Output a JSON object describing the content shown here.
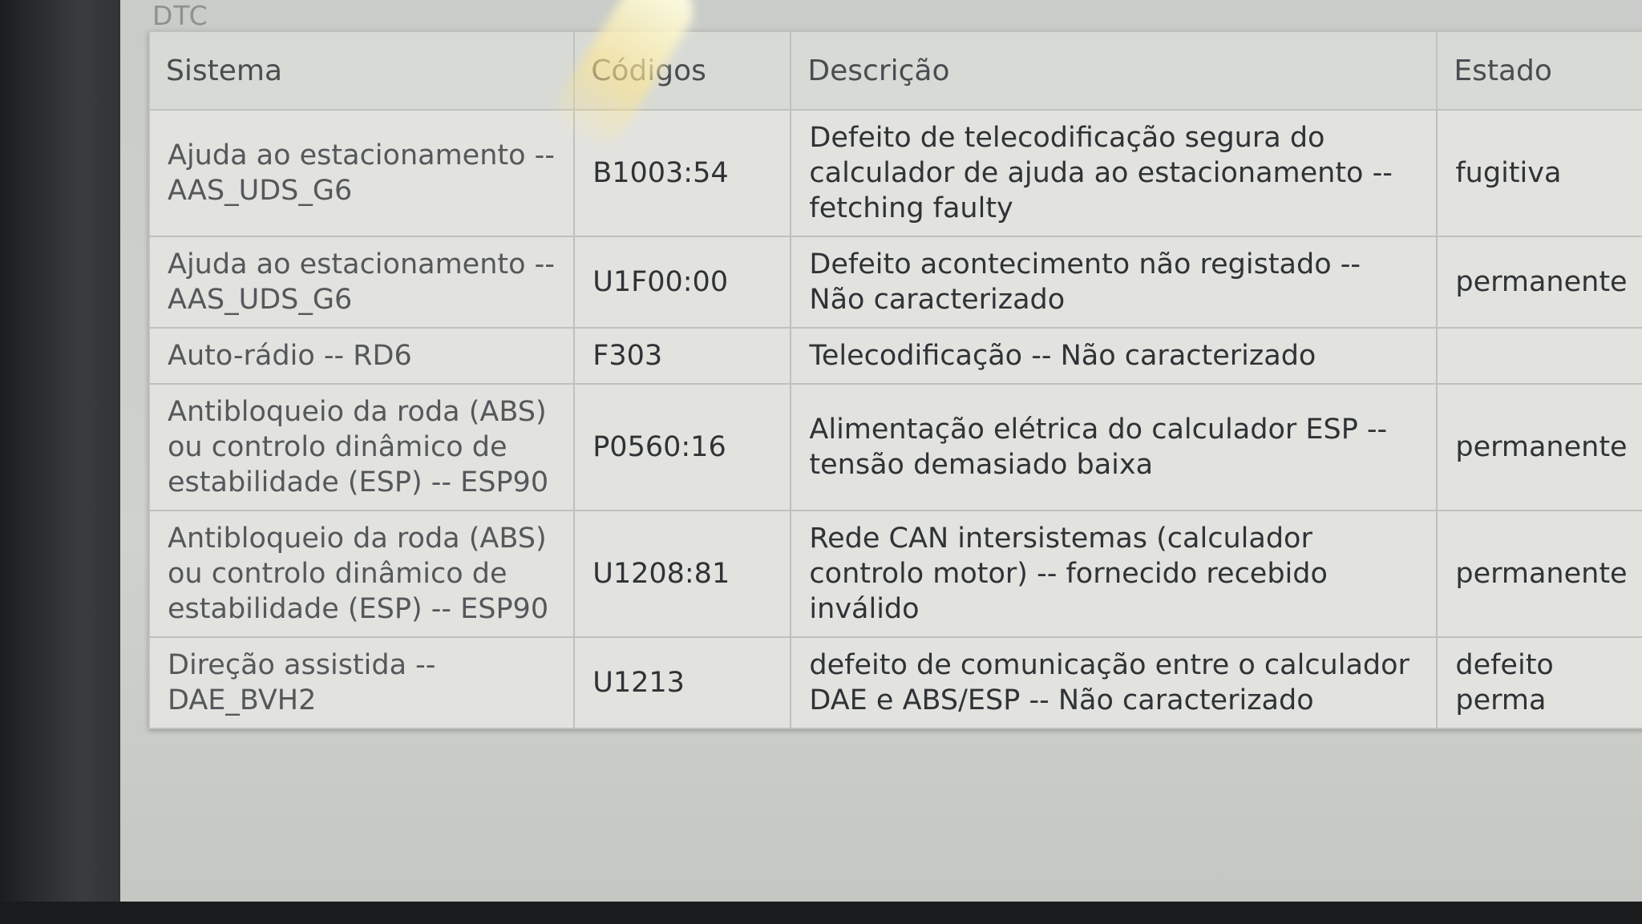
{
  "section": {
    "title": "DTC"
  },
  "table": {
    "headers": {
      "system": "Sistema",
      "code": "Códigos",
      "description": "Descrição",
      "state": "Estado"
    },
    "rows": [
      {
        "system": "Ajuda ao estacionamento -- AAS_UDS_G6",
        "code": "B1003:54",
        "description": "Defeito de telecodificação segura do calculador de ajuda ao estacionamento -- fetching faulty",
        "state": "fugitiva"
      },
      {
        "system": "Ajuda ao estacionamento -- AAS_UDS_G6",
        "code": "U1F00:00",
        "description": "Defeito acontecimento não registado -- Não caracterizado",
        "state": "permanente"
      },
      {
        "system": "Auto-rádio -- RD6",
        "code": "F303",
        "description": "Telecodificação -- Não caracterizado",
        "state": ""
      },
      {
        "system": "Antibloqueio da roda (ABS) ou controlo dinâmico de estabilidade (ESP) -- ESP90",
        "code": "P0560:16",
        "description": "Alimentação elétrica do calculador ESP -- tensão demasiado baixa",
        "state": "permanente"
      },
      {
        "system": "Antibloqueio da roda (ABS) ou controlo dinâmico de estabilidade (ESP) -- ESP90",
        "code": "U1208:81",
        "description": "Rede CAN intersistemas (calculador controlo motor) -- fornecido recebido inválido",
        "state": "permanente"
      },
      {
        "system": "Direção assistida -- DAE_BVH2",
        "code": "U1213",
        "description": "defeito de comunicação entre o calculador DAE e ABS/ESP -- Não caracterizado",
        "state": "defeito perma"
      }
    ]
  }
}
